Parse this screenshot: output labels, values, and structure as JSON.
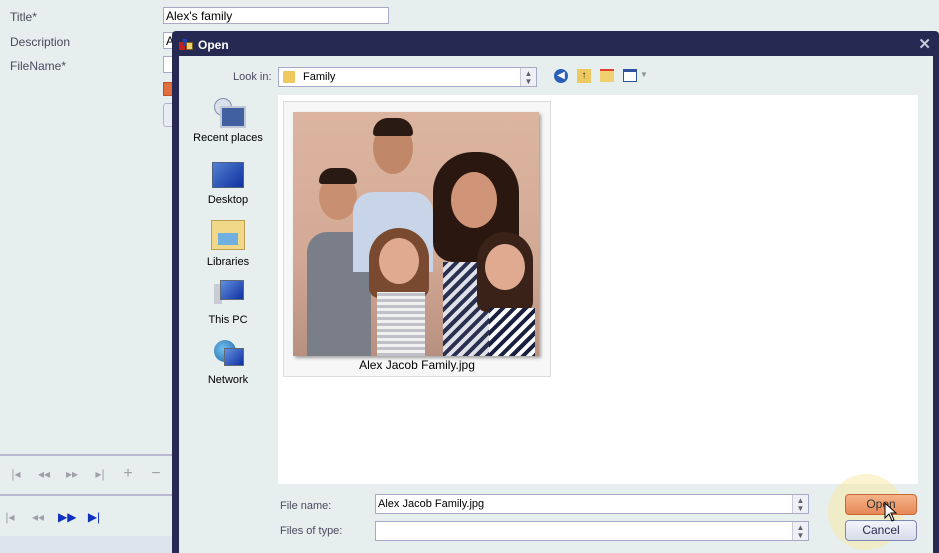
{
  "form": {
    "title_label": "Title*",
    "title_value": "Alex's family",
    "description_label": "Description",
    "description_value": "A",
    "filename_label": "FileName*"
  },
  "navigator_top": [
    "first-icon",
    "prev-page-icon",
    "next-page-icon",
    "last-icon",
    "add-icon",
    "remove-icon"
  ],
  "navigator_bottom": [
    "first-icon",
    "prev-page-icon",
    "next-page-icon",
    "last-icon"
  ],
  "dialog": {
    "title": "Open",
    "close_glyph": "✕",
    "look_in_label": "Look in:",
    "look_in_value": "Family",
    "places": [
      {
        "label": "Recent places",
        "icon": "recent-places-icon"
      },
      {
        "label": "Desktop",
        "icon": "desktop-icon"
      },
      {
        "label": "Libraries",
        "icon": "libraries-icon"
      },
      {
        "label": "This PC",
        "icon": "this-pc-icon"
      },
      {
        "label": "Network",
        "icon": "network-icon"
      }
    ],
    "files": [
      {
        "name": "Alex Jacob Family.jpg"
      }
    ],
    "file_name_label": "File name:",
    "file_name_value": "Alex Jacob Family.jpg",
    "file_type_label": "Files of type:",
    "file_type_value": "",
    "open_label": "Open",
    "cancel_label": "Cancel"
  },
  "colors": {
    "dialog_frame": "#262a52",
    "open_button": "#f0a070",
    "active_nav": "#1030c0"
  }
}
